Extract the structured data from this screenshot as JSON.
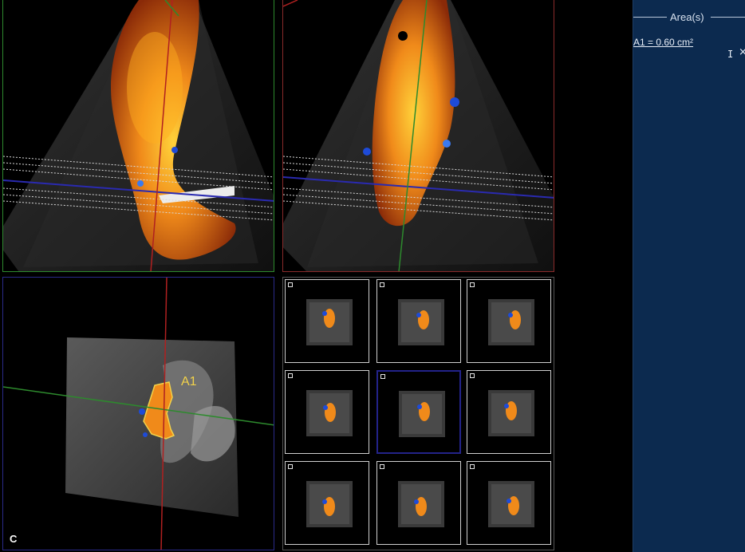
{
  "viewports": {
    "c": {
      "panel_letter": "C",
      "region_label": "A1"
    }
  },
  "side_panel": {
    "title": "Area(s)",
    "measurement": "A1 = 0.60 cm²",
    "icons": [
      "text-cursor-icon",
      "close-icon"
    ]
  },
  "slice_grid": {
    "rows": 3,
    "columns": 3,
    "selected_index": 4
  },
  "colors": {
    "flow_orange": "#f08a1a",
    "flow_blue": "#1e4bd8",
    "plane_green": "#2d8a2d",
    "plane_red": "#b02020",
    "plane_blue": "#2a2aa0",
    "panel_bg": "#0c2a4f",
    "label_yellow": "#f2d24a"
  }
}
